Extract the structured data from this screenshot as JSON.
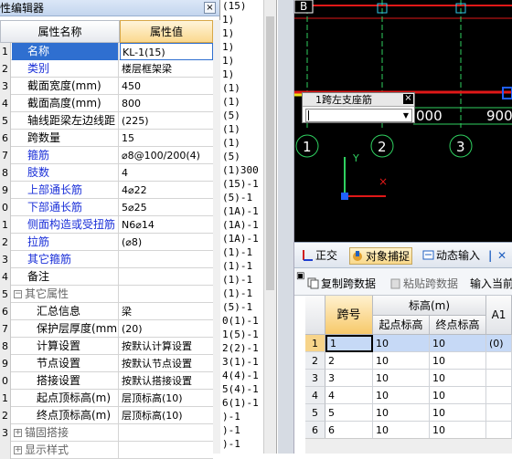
{
  "property_editor": {
    "title": "性编辑器",
    "close_glyph": "×",
    "header_name": "属性名称",
    "header_value": "属性值",
    "rows": [
      {
        "num": "1",
        "name": "名称",
        "value": "KL-1(15)",
        "style": "sel"
      },
      {
        "num": "2",
        "name": "类别",
        "value": "楼层框架梁",
        "style": "blue"
      },
      {
        "num": "3",
        "name": "截面宽度(mm)",
        "value": "450",
        "style": ""
      },
      {
        "num": "4",
        "name": "截面高度(mm)",
        "value": "800",
        "style": ""
      },
      {
        "num": "5",
        "name": "轴线距梁左边线距",
        "value": "(225)",
        "style": ""
      },
      {
        "num": "6",
        "name": "跨数量",
        "value": "15",
        "style": ""
      },
      {
        "num": "7",
        "name": "箍筋",
        "value": "⌀8@100/200(4)",
        "style": "blue"
      },
      {
        "num": "8",
        "name": "肢数",
        "value": "4",
        "style": "blue"
      },
      {
        "num": "9",
        "name": "上部通长筋",
        "value": "4⌀22",
        "style": "blue"
      },
      {
        "num": "0",
        "name": "下部通长筋",
        "value": "5⌀25",
        "style": "blue"
      },
      {
        "num": "1",
        "name": "侧面构造或受扭筋",
        "value": "N6⌀14",
        "style": "blue"
      },
      {
        "num": "2",
        "name": "拉筋",
        "value": "(⌀8)",
        "style": "blue"
      },
      {
        "num": "3",
        "name": "其它箍筋",
        "value": "",
        "style": "blue"
      },
      {
        "num": "4",
        "name": "备注",
        "value": "",
        "style": ""
      },
      {
        "num": "5",
        "name": "其它属性",
        "value": "",
        "style": "group"
      },
      {
        "num": "6",
        "name": "汇总信息",
        "value": "梁",
        "style": "child"
      },
      {
        "num": "7",
        "name": "保护层厚度(mm)",
        "value": "(20)",
        "style": "child"
      },
      {
        "num": "8",
        "name": "计算设置",
        "value": "按默认计算设置",
        "style": "child"
      },
      {
        "num": "9",
        "name": "节点设置",
        "value": "按默认节点设置",
        "style": "child"
      },
      {
        "num": "0",
        "name": "搭接设置",
        "value": "按默认搭接设置",
        "style": "child"
      },
      {
        "num": "1",
        "name": "起点顶标高(m)",
        "value": "层顶标高(10)",
        "style": "child"
      },
      {
        "num": "2",
        "name": "终点顶标高(m)",
        "value": "层顶标高(10)",
        "style": "child"
      },
      {
        "num": "3",
        "name": "锚固搭接",
        "value": "",
        "style": "group"
      },
      {
        "num": "",
        "name": "显示样式",
        "value": "",
        "style": "group"
      }
    ]
  },
  "log_lines": [
    "(15)",
    "1)",
    "1)",
    "1)",
    "1)",
    "1)",
    "(1)",
    "(1)",
    "(5)",
    "(1)",
    "(1)",
    "(5)",
    "(1)300",
    "(15)-1",
    "(5)-1",
    "(1A)-1",
    "(1A)-1",
    "(1A)-1",
    "(1)-1",
    "(1)-1",
    "(1)-1",
    "(1)-1",
    "(5)-1",
    "0(1)-1",
    "1(5)-1",
    "2(2)-1",
    "3(1)-1",
    "4(4)-1",
    "5(4)-1",
    "6(1)-1",
    ")-1",
    ")-1",
    ")-1"
  ],
  "cad": {
    "popup_title": "1跨左支座筋",
    "popup_close": "×",
    "axis_labels": [
      "1",
      "2",
      "3"
    ],
    "dim_labels": [
      "000",
      "900"
    ],
    "top_label": "B",
    "y_axis": "Y",
    "x_mark": "×",
    "colors": {
      "background": "#000000",
      "red": "#e01818",
      "green": "#2fd060",
      "cyan": "#30c8e8",
      "yellow": "#e8e018",
      "blue": "#2060ff"
    }
  },
  "toolbar1": {
    "items": [
      "正交",
      "对象捕捉",
      "动态输入"
    ],
    "left_glyph": "|",
    "right_glyph": "✕"
  },
  "toolbar2": {
    "copy": "复制跨数据",
    "paste": "粘贴跨数据",
    "input": "输入当前"
  },
  "grid": {
    "headers": {
      "span": "跨号",
      "elev": "标高(m)",
      "start": "起点标高",
      "end": "终点标高",
      "a1": "A1"
    },
    "rows": [
      {
        "rn": "1",
        "span": "1",
        "start": "10",
        "end": "10",
        "a1": "(0)"
      },
      {
        "rn": "2",
        "span": "2",
        "start": "10",
        "end": "10",
        "a1": ""
      },
      {
        "rn": "3",
        "span": "3",
        "start": "10",
        "end": "10",
        "a1": ""
      },
      {
        "rn": "4",
        "span": "4",
        "start": "10",
        "end": "10",
        "a1": ""
      },
      {
        "rn": "5",
        "span": "5",
        "start": "10",
        "end": "10",
        "a1": ""
      },
      {
        "rn": "6",
        "span": "6",
        "start": "10",
        "end": "10",
        "a1": ""
      }
    ]
  }
}
